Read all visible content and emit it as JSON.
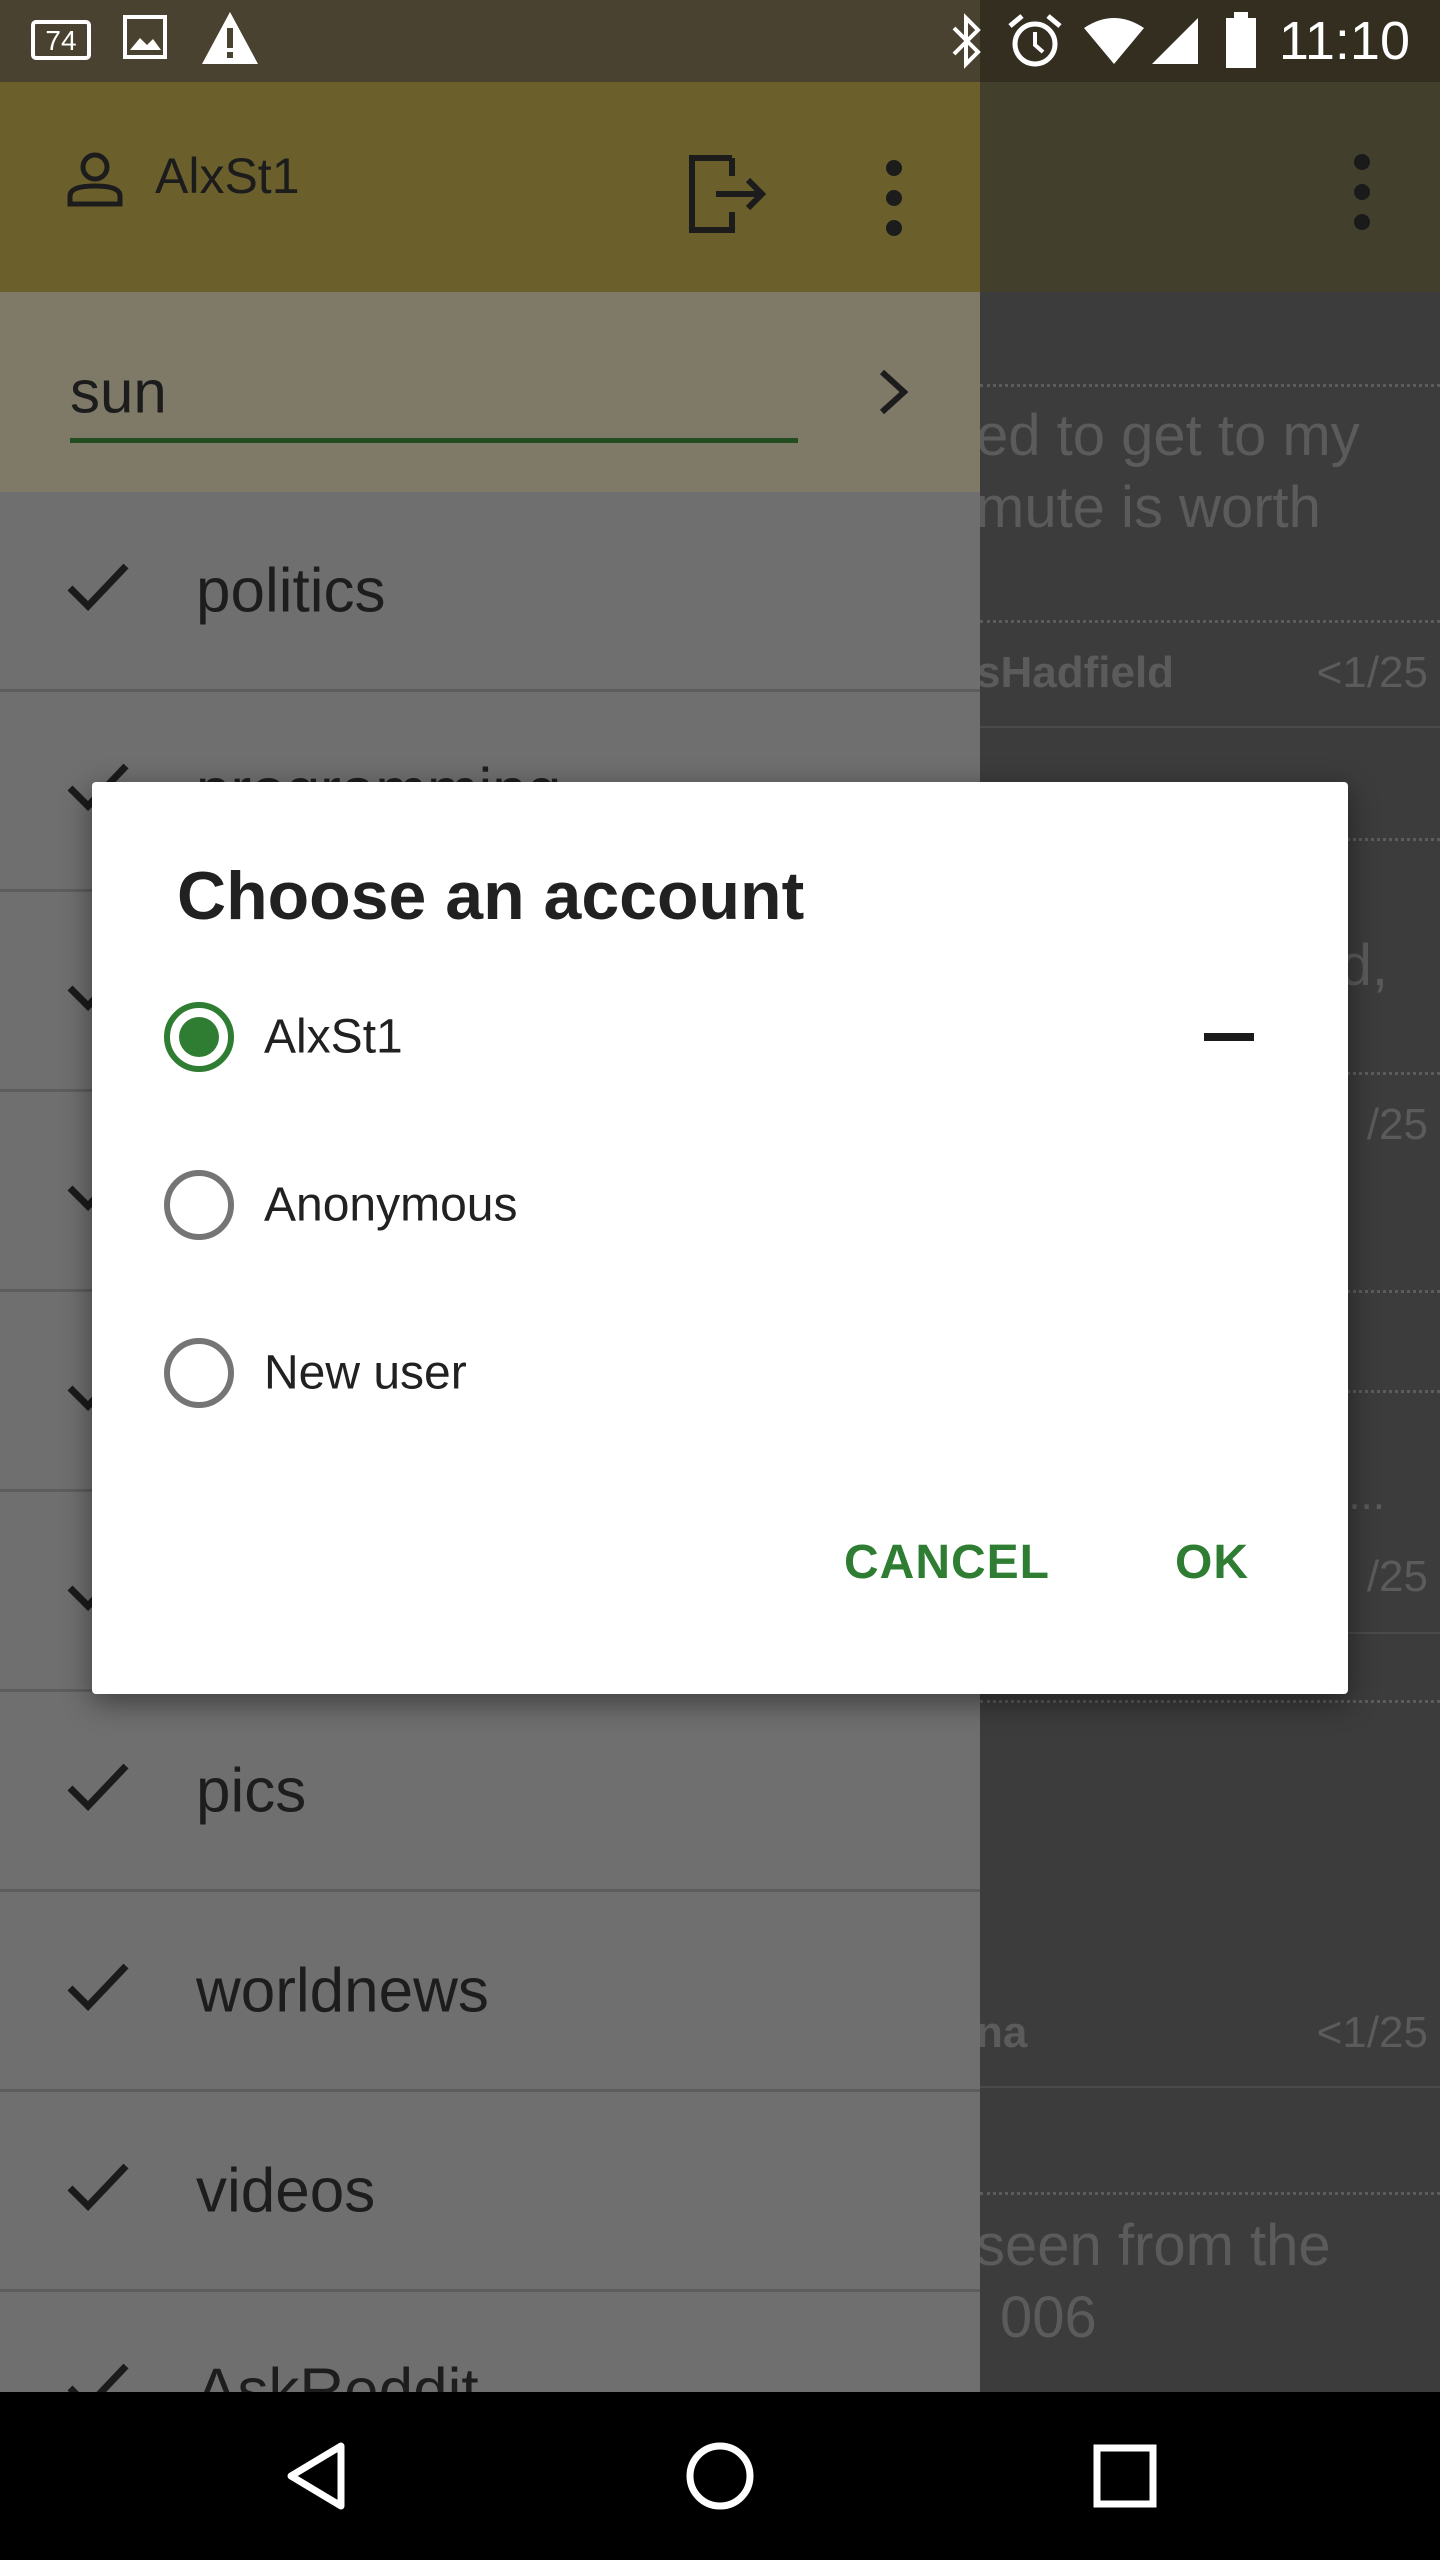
{
  "status_bar": {
    "left_badge": "74",
    "time": "11:10",
    "icons": [
      "notification-74-icon",
      "image-icon",
      "warning-icon",
      "bluetooth-icon",
      "alarm-icon",
      "wifi-icon",
      "signal-icon",
      "battery-icon"
    ]
  },
  "drawer": {
    "username": "AlxSt1",
    "search_value": "sun",
    "subreddits": [
      "politics",
      "programming",
      "",
      "",
      "",
      "",
      "pics",
      "worldnews",
      "videos",
      "AskReddit"
    ]
  },
  "background_feed": {
    "line1": "ed to get to my",
    "line2": "mute is worth",
    "meta1_author": "sHadfield",
    "meta1_count": "<1/25",
    "frag_d": "d,",
    "frag_25a": "/25",
    "frag_dots": "...",
    "frag_25b": "/25",
    "meta2_author": "na",
    "meta2_count": "<1/25",
    "line3": "seen from the",
    "line4": "006"
  },
  "dialog": {
    "title": "Choose an account",
    "options": [
      {
        "label": "AlxSt1",
        "selected": true
      },
      {
        "label": "Anonymous",
        "selected": false
      },
      {
        "label": "New user",
        "selected": false
      }
    ],
    "cancel_label": "CANCEL",
    "ok_label": "OK",
    "accent_color": "#2e7d32"
  },
  "nav_bar": {
    "buttons": [
      "back-icon",
      "home-icon",
      "recents-icon"
    ]
  }
}
